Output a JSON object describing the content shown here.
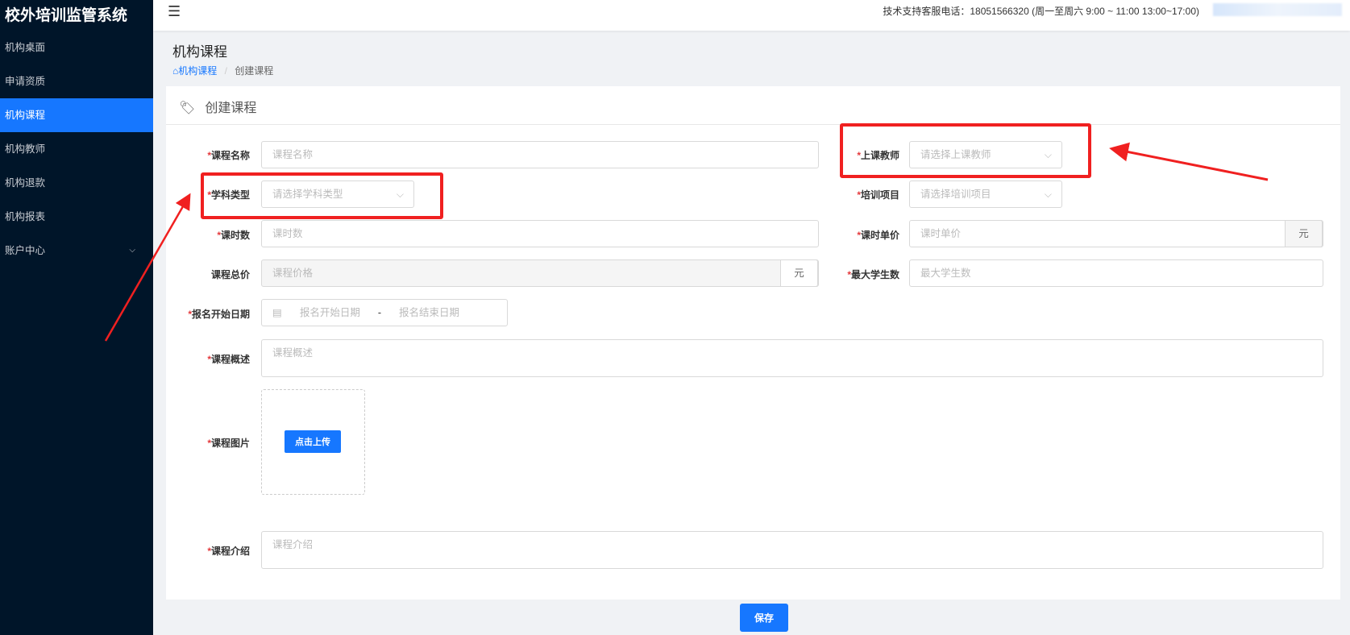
{
  "app_title": "校外培训监管系统",
  "sidebar": {
    "items": [
      {
        "label": "机构桌面"
      },
      {
        "label": "申请资质"
      },
      {
        "label": "机构课程",
        "active": true
      },
      {
        "label": "机构教师"
      },
      {
        "label": "机构退款"
      },
      {
        "label": "机构报表"
      },
      {
        "label": "账户中心",
        "has_submenu": true
      }
    ]
  },
  "header": {
    "support": "技术支持客服电话：18051566320  (周一至周六 9:00 ~ 11:00 13:00~17:00)"
  },
  "page": {
    "title": "机构课程",
    "breadcrumb": [
      "机构课程",
      "创建课程"
    ]
  },
  "card": {
    "title": "创建课程"
  },
  "form": {
    "course_name": {
      "label": "课程名称",
      "placeholder": "课程名称"
    },
    "teacher": {
      "label": "上课教师",
      "placeholder": "请选择上课教师"
    },
    "subject": {
      "label": "学科类型",
      "placeholder": "请选择学科类型"
    },
    "project": {
      "label": "培训项目",
      "placeholder": "请选择培训项目"
    },
    "hours": {
      "label": "课时数",
      "placeholder": "课时数"
    },
    "unit_price": {
      "label": "课时单价",
      "placeholder": "课时单价",
      "unit": "元"
    },
    "total": {
      "label": "课程总价",
      "placeholder": "课程价格",
      "unit": "元"
    },
    "max_students": {
      "label": "最大学生数",
      "placeholder": "最大学生数"
    },
    "enroll_date": {
      "label": "报名开始日期",
      "start": "报名开始日期",
      "sep": "-",
      "end": "报名结束日期"
    },
    "summary": {
      "label": "课程概述",
      "placeholder": "课程概述"
    },
    "image": {
      "label": "课程图片",
      "button": "点击上传"
    },
    "intro": {
      "label": "课程介绍",
      "placeholder": "课程介绍"
    },
    "required_mark": "*"
  },
  "save_label": "保存",
  "colors": {
    "primary": "#1677ff",
    "sidebar": "#001529",
    "annotation": "#f02020"
  }
}
